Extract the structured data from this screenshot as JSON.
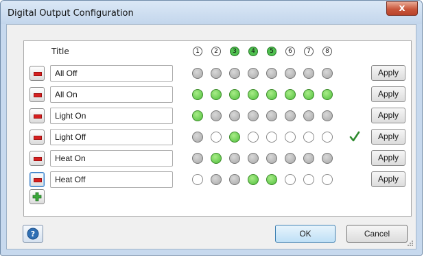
{
  "window": {
    "title": "Digital Output Configuration",
    "close_label": "x"
  },
  "grid": {
    "title_header": "Title",
    "channels": [
      {
        "label": "1",
        "highlighted": false
      },
      {
        "label": "2",
        "highlighted": false
      },
      {
        "label": "3",
        "highlighted": true
      },
      {
        "label": "4",
        "highlighted": true
      },
      {
        "label": "5",
        "highlighted": true
      },
      {
        "label": "6",
        "highlighted": false
      },
      {
        "label": "7",
        "highlighted": false
      },
      {
        "label": "8",
        "highlighted": false
      }
    ],
    "rows": [
      {
        "title": "All Off",
        "states": [
          "off",
          "off",
          "off",
          "off",
          "off",
          "off",
          "off",
          "off"
        ],
        "applied": false,
        "focused": false
      },
      {
        "title": "All On",
        "states": [
          "on",
          "on",
          "on",
          "on",
          "on",
          "on",
          "on",
          "on"
        ],
        "applied": false,
        "focused": false
      },
      {
        "title": "Light On",
        "states": [
          "on",
          "off",
          "off",
          "off",
          "off",
          "off",
          "off",
          "off"
        ],
        "applied": false,
        "focused": false
      },
      {
        "title": "Light Off",
        "states": [
          "off",
          "empty",
          "on",
          "empty",
          "empty",
          "empty",
          "empty",
          "empty"
        ],
        "applied": true,
        "focused": false
      },
      {
        "title": "Heat On",
        "states": [
          "off",
          "on",
          "off",
          "off",
          "off",
          "off",
          "off",
          "off"
        ],
        "applied": false,
        "focused": false
      },
      {
        "title": "Heat Off",
        "states": [
          "empty",
          "off",
          "off",
          "on",
          "on",
          "empty",
          "empty",
          "empty"
        ],
        "applied": false,
        "focused": true
      }
    ],
    "apply_label": "Apply"
  },
  "footer": {
    "ok_label": "OK",
    "cancel_label": "Cancel"
  },
  "icons": {
    "remove": "remove-icon",
    "add": "add-icon",
    "help": "help-icon",
    "applied": "checkmark-icon",
    "close": "close-icon"
  },
  "colors": {
    "led_on": "#4fbf3c",
    "led_off": "#a8a8a8",
    "remove_red": "#d62020",
    "add_green": "#3aa83a",
    "check_green": "#2e8a2e"
  }
}
